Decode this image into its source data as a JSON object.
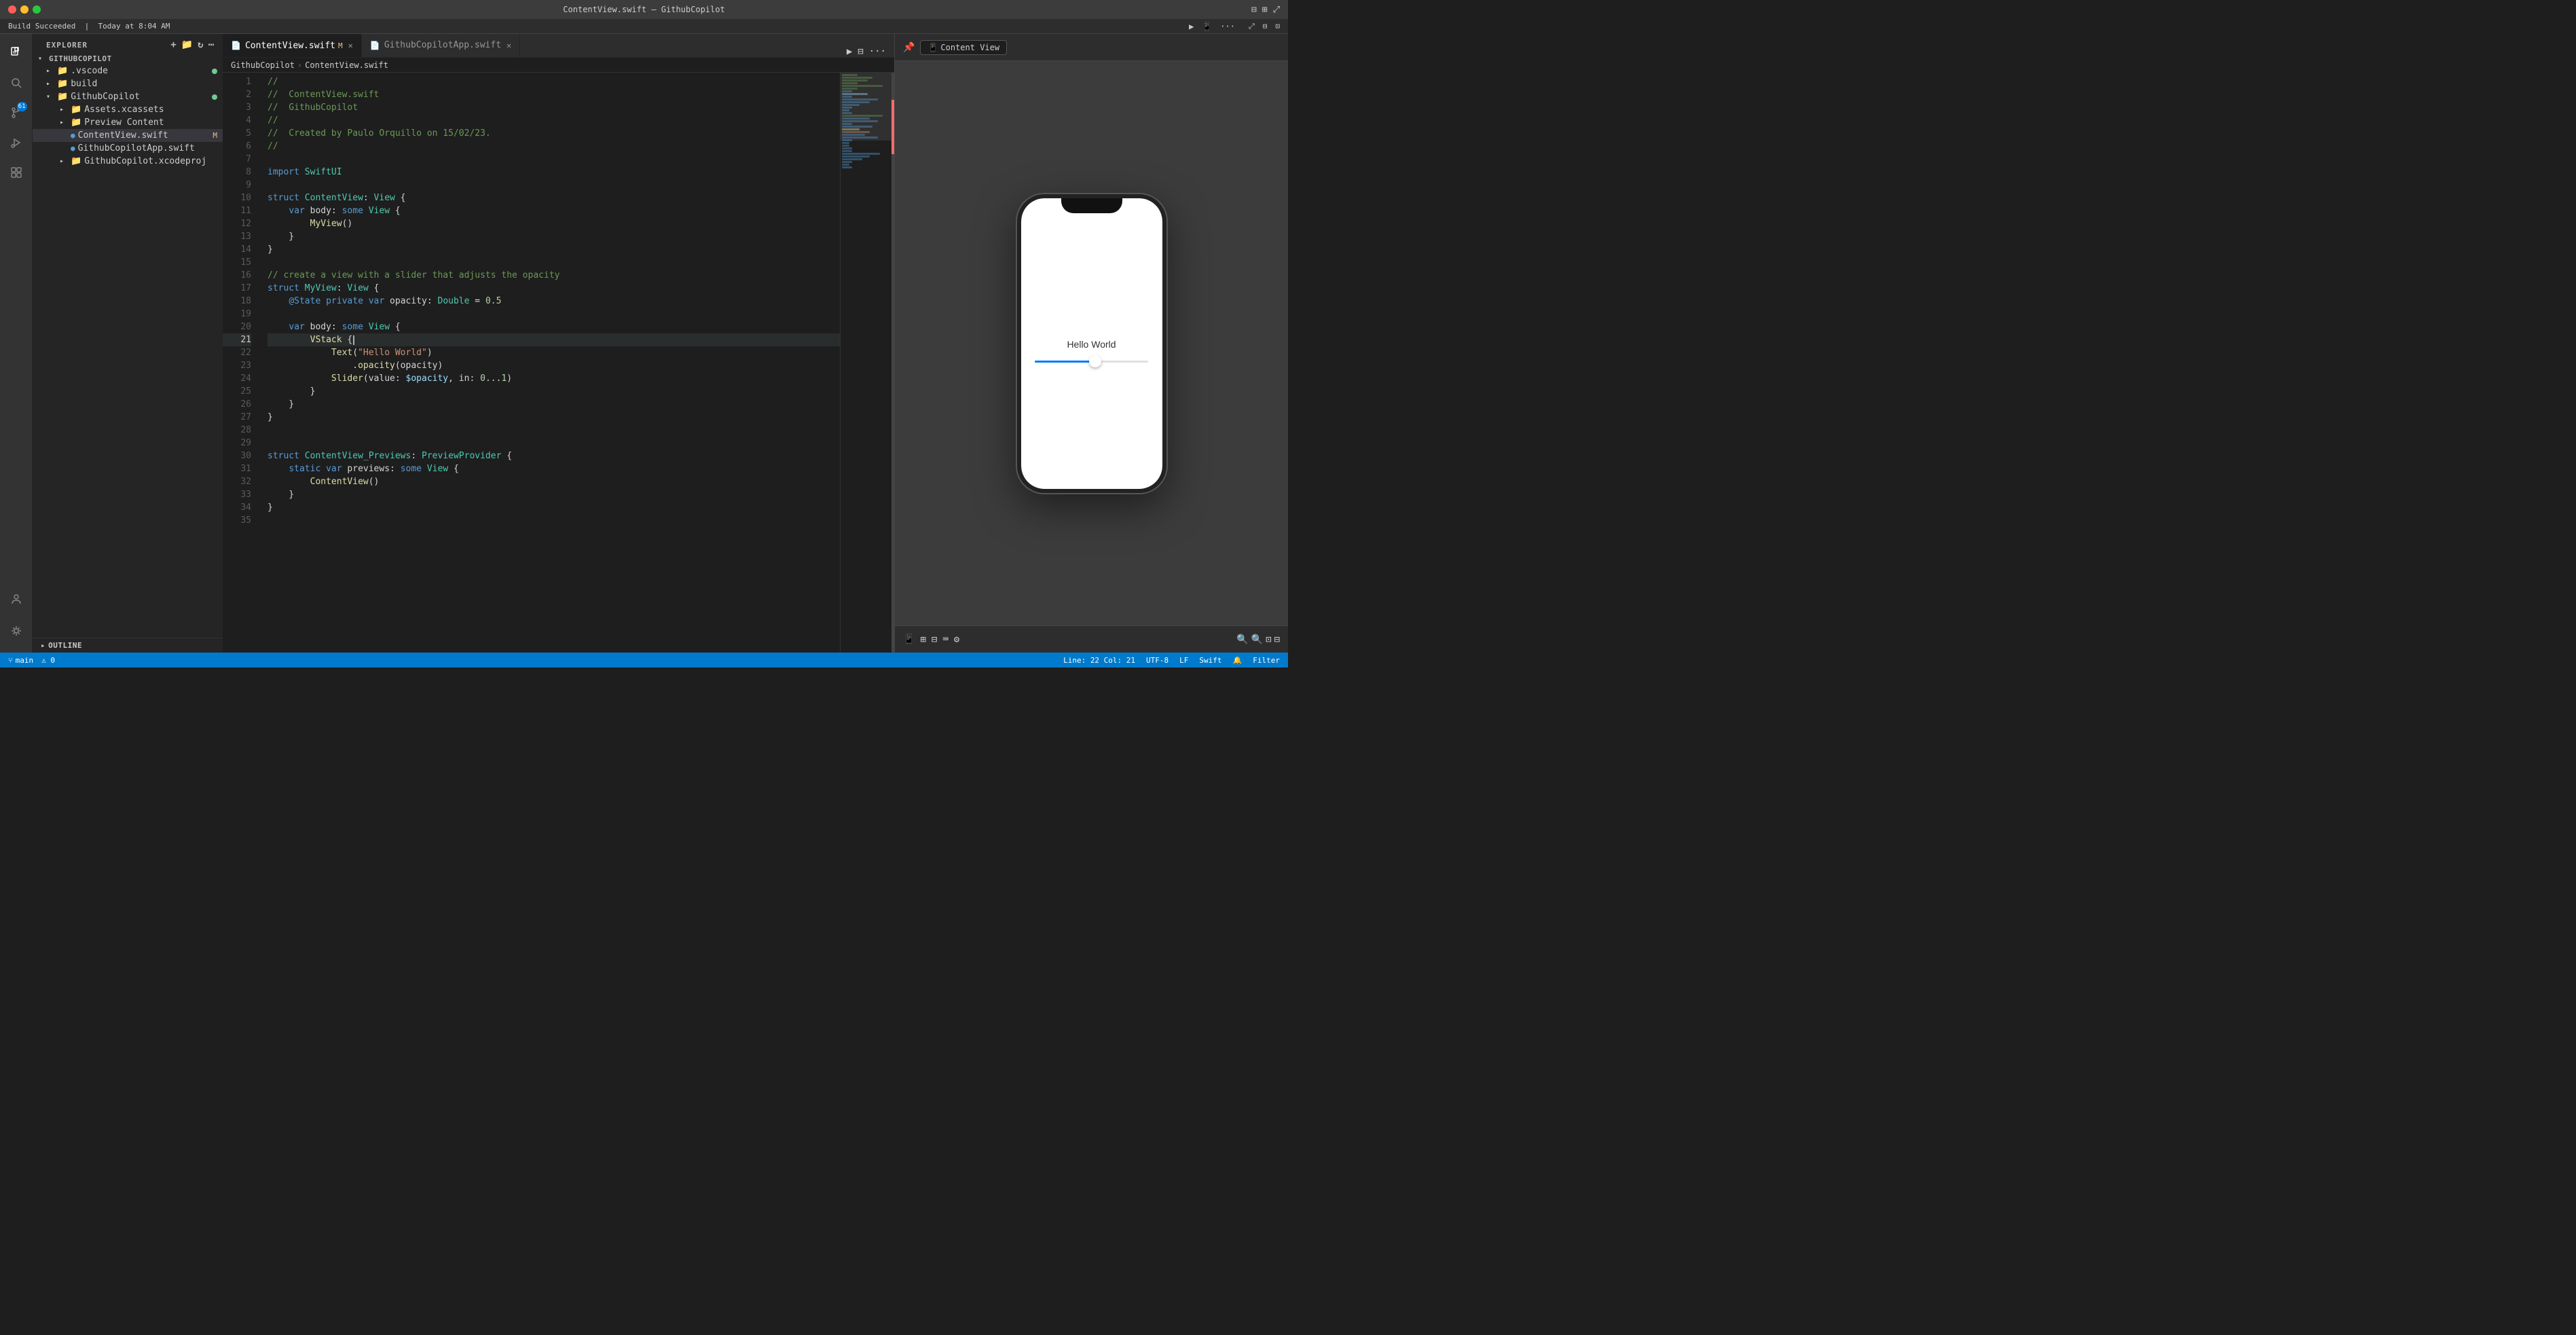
{
  "titleBar": {
    "title": "ContentView.swift — GithubCopilot",
    "trafficLights": [
      "close",
      "minimize",
      "maximize"
    ]
  },
  "buildBar": {
    "status": "Build Succeeded",
    "time": "Today at 8:04 AM"
  },
  "activityBar": {
    "icons": [
      {
        "name": "files-icon",
        "symbol": "⬛",
        "active": true,
        "badge": null
      },
      {
        "name": "search-icon",
        "symbol": "🔍",
        "active": false,
        "badge": null
      },
      {
        "name": "source-control-icon",
        "symbol": "⑂",
        "active": false,
        "badge": "61"
      },
      {
        "name": "run-icon",
        "symbol": "▶",
        "active": false,
        "badge": null
      },
      {
        "name": "extensions-icon",
        "symbol": "⊞",
        "active": false,
        "badge": null
      }
    ],
    "bottomIcons": [
      {
        "name": "account-icon",
        "symbol": "👤"
      },
      {
        "name": "settings-icon",
        "symbol": "⚙"
      }
    ]
  },
  "sidebar": {
    "header": "Explorer",
    "root": "GITHUBCOPILOT",
    "items": [
      {
        "label": ".vscode",
        "type": "folder",
        "indent": 1,
        "expanded": false,
        "dot": true
      },
      {
        "label": "build",
        "type": "folder",
        "indent": 1,
        "expanded": false,
        "dot": false
      },
      {
        "label": "GithubCopilot",
        "type": "folder",
        "indent": 1,
        "expanded": true,
        "dot": true
      },
      {
        "label": "Assets.xcassets",
        "type": "folder",
        "indent": 2,
        "expanded": false
      },
      {
        "label": "Preview Content",
        "type": "folder",
        "indent": 2,
        "expanded": false
      },
      {
        "label": "ContentView.swift",
        "type": "file-swift",
        "indent": 2,
        "active": true,
        "modified": true
      },
      {
        "label": "GithubCopilotApp.swift",
        "type": "file-swift",
        "indent": 2,
        "active": false
      },
      {
        "label": "GithubCopilot.xcodeproj",
        "type": "folder",
        "indent": 2,
        "expanded": false
      }
    ],
    "outline": "OUTLINE"
  },
  "tabs": [
    {
      "label": "ContentView.swift",
      "active": true,
      "modified": true,
      "icon": "📄"
    },
    {
      "label": "GithubCopilotApp.swift",
      "active": false,
      "icon": "📄"
    }
  ],
  "breadcrumb": {
    "parts": [
      "GithubCopilot",
      "ContentView.swift"
    ]
  },
  "editor": {
    "lines": [
      {
        "num": 1,
        "content": "//",
        "type": "comment"
      },
      {
        "num": 2,
        "content": "//  ContentView.swift",
        "type": "comment"
      },
      {
        "num": 3,
        "content": "//  GithubCopilot",
        "type": "comment"
      },
      {
        "num": 4,
        "content": "//",
        "type": "comment"
      },
      {
        "num": 5,
        "content": "//  Created by Paulo Orquillo on 15/02/23.",
        "type": "comment"
      },
      {
        "num": 6,
        "content": "//",
        "type": "comment"
      },
      {
        "num": 7,
        "content": "",
        "type": "plain"
      },
      {
        "num": 8,
        "content": "import SwiftUI",
        "type": "import"
      },
      {
        "num": 9,
        "content": "",
        "type": "plain"
      },
      {
        "num": 10,
        "content": "struct ContentView: View {",
        "type": "code"
      },
      {
        "num": 11,
        "content": "    var body: some View {",
        "type": "code"
      },
      {
        "num": 12,
        "content": "        MyView()",
        "type": "code"
      },
      {
        "num": 13,
        "content": "    }",
        "type": "code"
      },
      {
        "num": 14,
        "content": "}",
        "type": "code"
      },
      {
        "num": 15,
        "content": "",
        "type": "plain"
      },
      {
        "num": 16,
        "content": "// create a view with a slider that adjusts the opacity",
        "type": "comment"
      },
      {
        "num": 17,
        "content": "struct MyView: View {",
        "type": "code"
      },
      {
        "num": 18,
        "content": "    @State private var opacity: Double = 0.5",
        "type": "code"
      },
      {
        "num": 19,
        "content": "",
        "type": "plain"
      },
      {
        "num": 20,
        "content": "    var body: some View {",
        "type": "code"
      },
      {
        "num": 21,
        "content": "        VStack {",
        "type": "code",
        "cursor": true
      },
      {
        "num": 22,
        "content": "            Text(\"Hello World\")",
        "type": "code"
      },
      {
        "num": 23,
        "content": "                .opacity(opacity)",
        "type": "code"
      },
      {
        "num": 24,
        "content": "            Slider(value: $opacity, in: 0...1)",
        "type": "code"
      },
      {
        "num": 25,
        "content": "        }",
        "type": "code"
      },
      {
        "num": 26,
        "content": "    }",
        "type": "code"
      },
      {
        "num": 27,
        "content": "}",
        "type": "code"
      },
      {
        "num": 28,
        "content": "",
        "type": "plain"
      },
      {
        "num": 29,
        "content": "",
        "type": "plain"
      },
      {
        "num": 30,
        "content": "struct ContentView_Previews: PreviewProvider {",
        "type": "code"
      },
      {
        "num": 31,
        "content": "    static var previews: some View {",
        "type": "code"
      },
      {
        "num": 32,
        "content": "        ContentView()",
        "type": "code"
      },
      {
        "num": 33,
        "content": "    }",
        "type": "code"
      },
      {
        "num": 34,
        "content": "}",
        "type": "code"
      },
      {
        "num": 35,
        "content": "",
        "type": "plain"
      }
    ]
  },
  "preview": {
    "toolbar": {
      "contentViewBtn": "Content View"
    },
    "phone": {
      "text": "Hello World",
      "sliderValue": 50
    },
    "bottomBar": {
      "icons": [
        "device-icon",
        "grid-icon",
        "layout-icon",
        "keyboard-icon",
        "settings-icon"
      ]
    },
    "zoomControls": [
      "zoom-out",
      "zoom-in",
      "zoom-fit",
      "zoom-reset"
    ]
  },
  "statusBar": {
    "left": [],
    "right": {
      "position": "Line: 22  Col: 21"
    }
  }
}
